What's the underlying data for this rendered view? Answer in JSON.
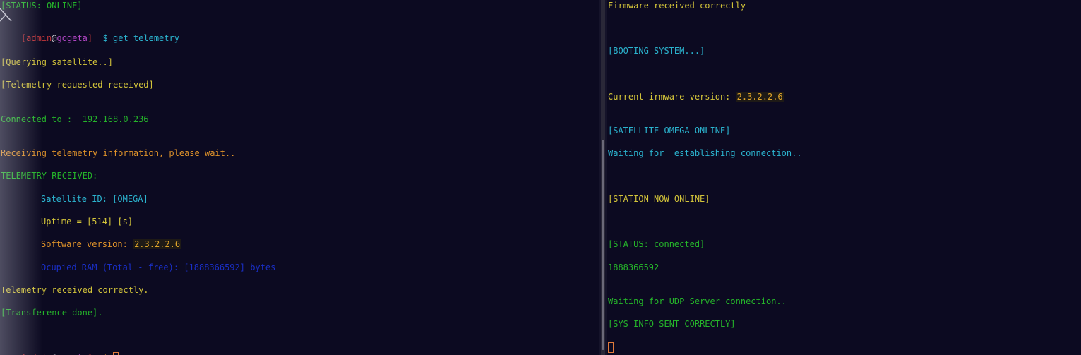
{
  "left_terminal": {
    "status_line": "[STATUS: ONLINE]",
    "prompt1": {
      "open": "[",
      "user": "admin",
      "at": "@",
      "host": "gogeta",
      "close": "]",
      "symbol": "$",
      "command": "get telemetry"
    },
    "querying": "[Querying satellite..]",
    "telemetry_requested": "[Telemetry requested received]",
    "connected_label": "Connected to :",
    "connected_ip": "192.168.0.236",
    "receiving": "Receiving telemetry information, please wait..",
    "telemetry_received_header": "TELEMETRY RECEIVED:",
    "satellite_id": "Satellite ID: [OMEGA]",
    "uptime": "Uptime = [514] [s]",
    "software_label": "Software version:",
    "software_version": "2.3.2.2.6",
    "ram_line": "Ocupied RAM (Total - free): [1888366592] bytes",
    "received_correctly": "Telemetry received correctly.",
    "transference_done": "[Transference done].",
    "prompt2": {
      "open": "[",
      "user": "admin",
      "at": "@",
      "host": "gogeta",
      "close": "]",
      "symbol": "$"
    }
  },
  "right_terminal": {
    "firmware_received": "Firmware received correctly",
    "booting": "[BOOTING SYSTEM...]",
    "current_firmware_label": "Current irmware version:",
    "current_firmware_version": "2.3.2.2.6",
    "satellite_online": "[SATELLITE OMEGA ONLINE]",
    "waiting_connection": "Waiting for  establishing connection..",
    "station_online": "[STATION NOW ONLINE]",
    "status_connected": "[STATUS: connected]",
    "ram_value": "1888366592",
    "waiting_udp": "Waiting for UDP Server connection..",
    "sys_info_sent": "[SYS INFO SENT CORRECTLY]"
  },
  "colors": {
    "background": "#0c0a21",
    "green": "#25b52a",
    "yellow": "#d3c43a",
    "orange": "#e0932a",
    "cyan": "#2bb4cf",
    "blue": "#1a2fc8",
    "red": "#c0353a",
    "magenta": "#b548c8"
  },
  "icons": {
    "close_mark": "close-icon"
  }
}
